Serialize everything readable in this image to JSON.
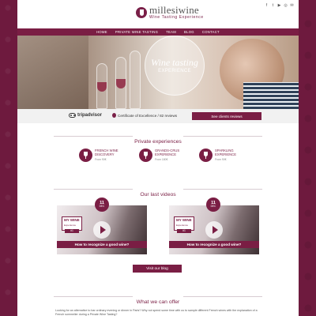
{
  "header": {
    "logo_name": "millesiwine",
    "logo_sub": "Wine Tasting Experience",
    "social": [
      "f",
      "t",
      "▶",
      "◎",
      "✉"
    ]
  },
  "nav": [
    "HOME",
    "PRIVATE WINE TASTING",
    "TEAM",
    "BLOG",
    "CONTACT"
  ],
  "hero": {
    "script": "Wine tasting",
    "caps": "EXPERIENCE"
  },
  "tripadvisor": {
    "logo": "tripadvisor",
    "certificate": "Certificate of Excellence / 82 reviews",
    "button": "See clients reviews"
  },
  "sections": {
    "private": "Private experiences",
    "videos": "Our last videos",
    "offer": "What we can offer"
  },
  "experiences": [
    {
      "name": "FRENCH WINE DISCOVERY",
      "price": "From 90€"
    },
    {
      "name": "GRANDS-CRUS EXPERIENCE",
      "price": "From 180€"
    },
    {
      "name": "SPARKLING EXPERIENCE",
      "price": "From 90€"
    }
  ],
  "videos": [
    {
      "day": "11",
      "month": "DEC",
      "brand": "MY WINE",
      "brand_sub": "Experience",
      "episode": "#1",
      "caption": "How to recognize a good wine?"
    },
    {
      "day": "11",
      "month": "DEC",
      "brand": "MY WINE",
      "brand_sub": "Experience",
      "episode": "#1",
      "caption": "How to recognize a good wine?"
    }
  ],
  "blog_button": "Visit our blog",
  "intro": "Looking for an alternative to bar ordinary evening or dinner in Paris? Why not spend some time with us to sample different French wines with the explanation of a French sommelier during a Private Wine Tasting?"
}
